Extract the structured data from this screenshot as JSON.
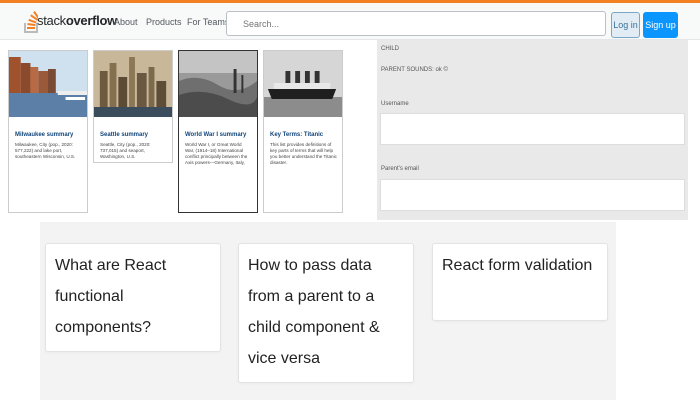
{
  "header": {
    "logo_text_plain": "stack",
    "logo_text_bold": "overflow",
    "nav": [
      "About",
      "Products",
      "For Teams"
    ],
    "search_placeholder": "Search...",
    "login_label": "Log in",
    "signup_label": "Sign up"
  },
  "topics": [
    {
      "title": "Milwaukee summary",
      "body": "Milwaukee, City (pop., 2020: 577,222) and lake port, southeastern Wisconsin, U.S."
    },
    {
      "title": "Seattle summary",
      "body": "Seattle, City (pop., 2020: 737,015) and seaport, Washington, U.S."
    },
    {
      "title": "World War I summary",
      "body": "World War I, or Great World War, (1914–18) International conflict principally between the Axis powers—Germany, Italy,"
    },
    {
      "title": "Key Terms: Titanic",
      "body": "This list provides definitions of key parts of terms that will help you better understand the Titanic disaster."
    }
  ],
  "form": {
    "child_label": "CHILD",
    "parent_label": "PARENT SOUNDS: ok ©",
    "username_label": "Username",
    "parent_email_label": "Parent's email"
  },
  "questions": [
    "What are React functional components?",
    "How to pass data from a parent to a child component & vice versa",
    "React form validation"
  ],
  "colors": {
    "accent": "#f48024",
    "link": "#12457a",
    "signup": "#0a95ff"
  }
}
